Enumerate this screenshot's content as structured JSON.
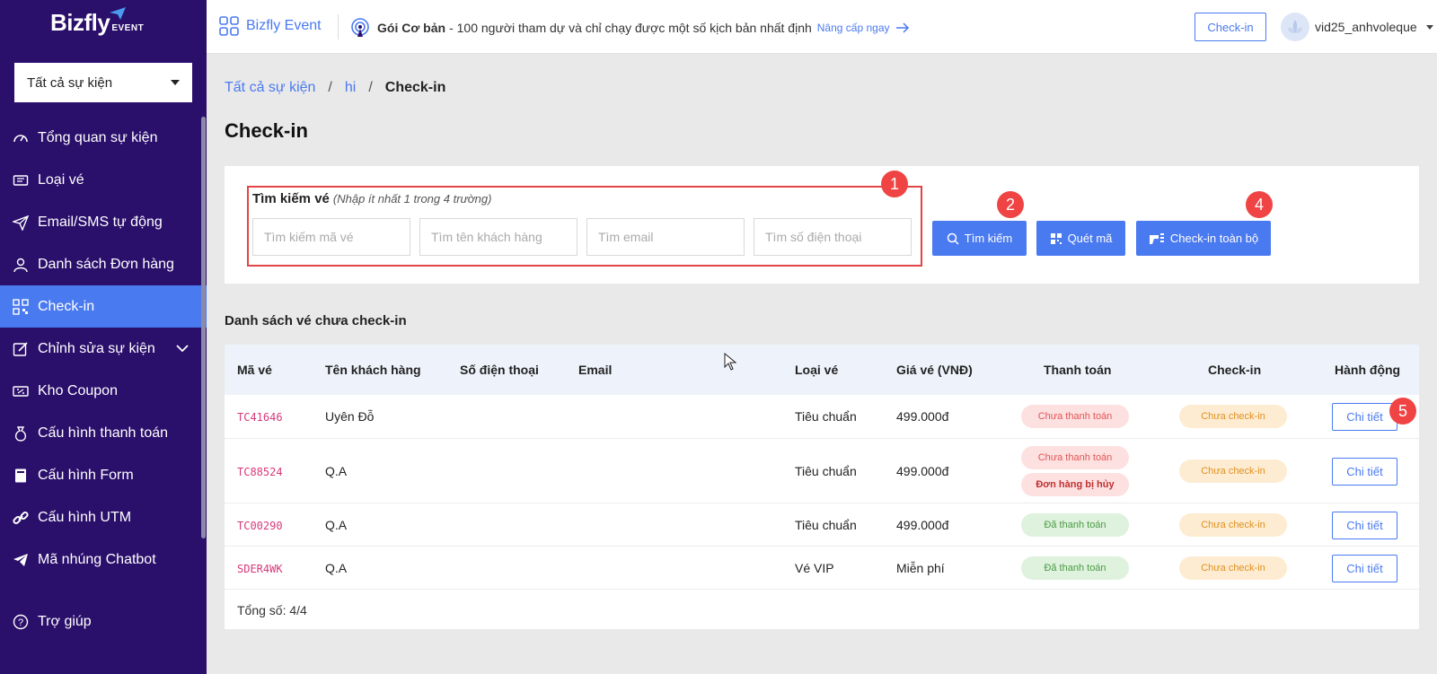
{
  "sidebar": {
    "logo_text": "Bizfly",
    "logo_sub": "EVENT",
    "event_select": "Tất cả sự kiện",
    "items": [
      {
        "label": "Tổng quan sự kiện",
        "icon": "dashboard-icon"
      },
      {
        "label": "Loại vé",
        "icon": "ticket-icon"
      },
      {
        "label": "Email/SMS tự động",
        "icon": "send-icon"
      },
      {
        "label": "Danh sách Đơn hàng",
        "icon": "user-icon"
      },
      {
        "label": "Check-in",
        "icon": "qr-icon",
        "active": true
      },
      {
        "label": "Chỉnh sửa sự kiện",
        "icon": "edit-icon"
      },
      {
        "label": "Kho Coupon",
        "icon": "coupon-icon"
      },
      {
        "label": "Cấu hình thanh toán",
        "icon": "money-bag-icon"
      },
      {
        "label": "Cấu hình Form",
        "icon": "book-icon"
      },
      {
        "label": "Cấu hình UTM",
        "icon": "link-icon"
      },
      {
        "label": "Mã nhúng Chatbot",
        "icon": "telegram-icon"
      }
    ],
    "help": "Trợ giúp"
  },
  "topbar": {
    "brand": "Bizfly Event",
    "plan_name": "Gói Cơ bản",
    "plan_desc": "- 100 người tham dự và chỉ chạy được một số kịch bản nhất định",
    "upgrade": "Nâng cấp ngay",
    "checkin_button": "Check-in",
    "username": "vid25_anhvoleque"
  },
  "breadcrumb": {
    "all": "Tất cả sự kiện",
    "event": "hi",
    "current": "Check-in",
    "sep": "/"
  },
  "page_title": "Check-in",
  "search": {
    "label": "Tìm kiếm vé",
    "hint": "(Nhập ít nhất 1 trong 4 trường)",
    "placeholders": {
      "code": "Tìm kiếm mã vé",
      "name": "Tìm tên khách hàng",
      "email": "Tìm email",
      "phone": "Tìm số điện thoại"
    },
    "search_button": "Tìm kiếm",
    "scan_button": "Quét mã",
    "checkin_all_button": "Check-in toàn bộ"
  },
  "markers": [
    "1",
    "2",
    "4",
    "5"
  ],
  "list_title": "Danh sách vé chưa check-in",
  "table": {
    "headers": [
      "Mã vé",
      "Tên khách hàng",
      "Số điện thoại",
      "Email",
      "Loại vé",
      "Giá vé (VNĐ)",
      "Thanh toán",
      "Check-in",
      "Hành động"
    ],
    "rows": [
      {
        "code": "TC41646",
        "name": "Uyên Đỗ",
        "phone": "",
        "email": "",
        "type": "Tiêu chuẩn",
        "price": "499.000đ",
        "payment": [
          "Chưa thanh toán"
        ],
        "checkin": "Chưa check-in",
        "action": "Chi tiết"
      },
      {
        "code": "TC88524",
        "name": "Q.A",
        "phone": "",
        "email": "",
        "type": "Tiêu chuẩn",
        "price": "499.000đ",
        "payment": [
          "Chưa thanh toán",
          "Đơn hàng bị hủy"
        ],
        "checkin": "Chưa check-in",
        "action": "Chi tiết"
      },
      {
        "code": "TC00290",
        "name": "Q.A",
        "phone": "",
        "email": "",
        "type": "Tiêu chuẩn",
        "price": "499.000đ",
        "payment": [
          "Đã thanh toán"
        ],
        "checkin": "Chưa check-in",
        "action": "Chi tiết"
      },
      {
        "code": "SDER4WK",
        "name": "Q.A",
        "phone": "",
        "email": "",
        "type": "Vé VIP",
        "price": "Miễn phí",
        "payment": [
          "Đã thanh toán"
        ],
        "checkin": "Chưa check-in",
        "action": "Chi tiết"
      }
    ],
    "total": "Tổng số: 4/4"
  },
  "colors": {
    "sidebar": "#2a0f6b",
    "accent": "#4a7af0",
    "marker": "#f04444"
  }
}
